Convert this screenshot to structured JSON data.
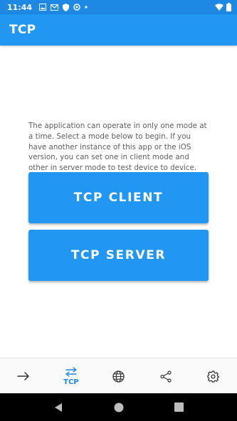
{
  "status_bar": {
    "time": "11:44",
    "left_icons": [
      "image-icon",
      "gmail-icon",
      "shield-icon",
      "sync-icon",
      "dot-icon"
    ],
    "right_icons": [
      "wifi-icon",
      "battery-icon"
    ]
  },
  "app_bar": {
    "title": "TCP",
    "color": "#2196f3"
  },
  "main": {
    "description": "The application can operate in only one mode at a time. Select a mode below to begin. If you have another instance of this app or the iOS version, you can set one in client mode and other in server mode to test device to device.",
    "client_button_label": "TCP CLIENT",
    "server_button_label": "TCP SERVER"
  },
  "bottom_nav": {
    "items": [
      {
        "icon": "arrow-right-icon",
        "label": ""
      },
      {
        "icon": "swap-arrows-icon",
        "label": "TCP",
        "active": true
      },
      {
        "icon": "globe-icon",
        "label": ""
      },
      {
        "icon": "share-icon",
        "label": ""
      },
      {
        "icon": "gear-icon",
        "label": ""
      }
    ],
    "active_color": "#1e88e5"
  },
  "system_nav": [
    "back-icon",
    "home-icon",
    "recents-icon"
  ]
}
